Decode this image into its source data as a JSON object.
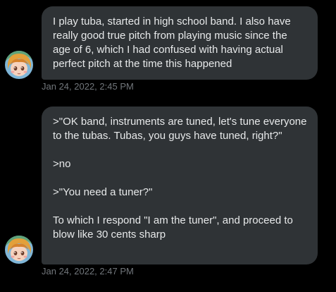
{
  "messages": [
    {
      "paragraphs": [
        "I play tuba, started in high school band. I also have really good true pitch from playing music since the age of 6, which I had confused with having actual perfect pitch at the time this happened"
      ],
      "timestamp": "Jan 24, 2022, 2:45 PM",
      "avatar_icon": "anime-avatar"
    },
    {
      "paragraphs": [
        ">\"OK band, instruments are tuned, let's tune everyone to the tubas. Tubas, you guys have tuned, right?\"",
        ">no",
        ">\"You need a tuner?\"",
        "To which I respond \"I am the tuner\", and proceed to blow like 30 cents sharp"
      ],
      "timestamp": "Jan 24, 2022, 2:47 PM",
      "avatar_icon": "anime-avatar"
    }
  ],
  "colors": {
    "background": "#000000",
    "bubble": "#2f3336",
    "text": "#e7e9ea",
    "timestamp": "#71767b"
  }
}
